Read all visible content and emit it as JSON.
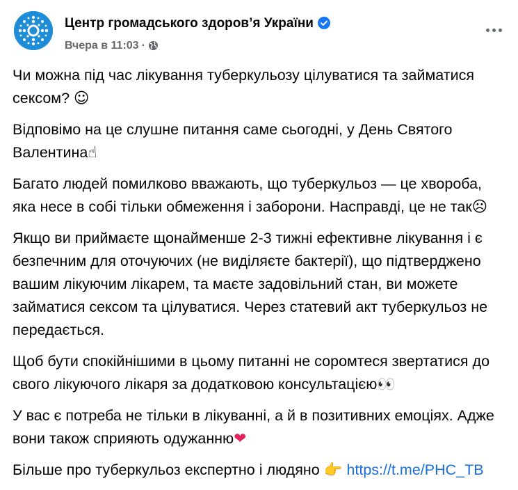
{
  "post": {
    "author": "Центр громадського здоров’я України",
    "timestamp": "Вчера в 11:03",
    "audience_icon": "globe-icon",
    "verified_icon": "verified-badge-icon",
    "accent_color": "#1877f2",
    "paragraphs": [
      {
        "text": "Чи можна під час лікування туберкульозу цілуватися та займатися сексом?",
        "emoji": "☺"
      },
      {
        "text": "Відповімо на це слушне питання саме сьогодні, у День Святого Валентина",
        "emoji": "☝"
      },
      {
        "text": "Багато людей помилково вважають, що туберкульоз — це хвороба, яка несе в собі тільки обмеження і заборони. Насправді, це не так",
        "emoji": "☹"
      },
      {
        "text": "Якщо ви приймаєте щонайменше 2-3 тижні ефективне лікування і є безпечним для оточуючих (не виділяєте бактерії), що підтверджено вашим лікуючим лікарем, та маєте задовільний стан, ви можете займатися сексом та цілуватися. Через статевий акт туберкульоз не передається.",
        "emoji": ""
      },
      {
        "text": "Щоб бути спокійнішими в цьому питанні не соромтеся звертатися до свого лікуючого лікаря за додатковою консультацією",
        "emoji": "👀"
      },
      {
        "text": "У вас є потреба не тільки в лікуванні, а й в позитивних емоціях. Адже вони також сприяють одужанню",
        "emoji": "❤"
      }
    ],
    "footer_text": "Більше про туберкульоз експертно і людяно",
    "footer_emoji": "👉",
    "link": "https://t.me/PHC_TB"
  }
}
